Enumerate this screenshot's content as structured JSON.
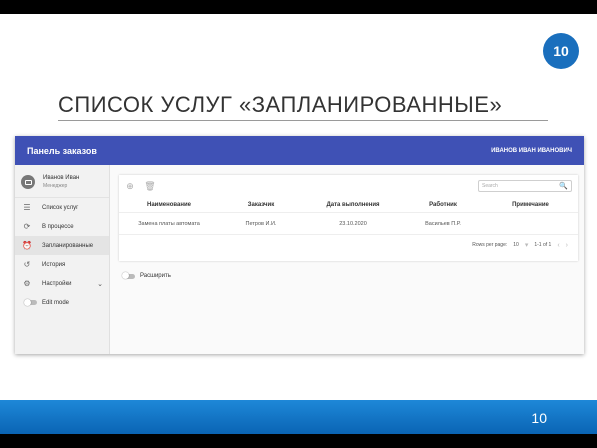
{
  "slide": {
    "badge": "10",
    "title": "СПИСОК УСЛУГ «ЗАПЛАНИРОВАННЫЕ»",
    "page_number": "10"
  },
  "app": {
    "header_title": "Панель заказов",
    "header_user": "ИВАНОВ ИВАН ИВАНОВИЧ"
  },
  "sidebar": {
    "user_name": "Иванов Иван",
    "user_role": "Менеджер",
    "items": [
      {
        "label": "Список услуг",
        "icon": "list-icon"
      },
      {
        "label": "В процессе",
        "icon": "sync-icon"
      },
      {
        "label": "Запланированные",
        "icon": "alarm-icon"
      },
      {
        "label": "История",
        "icon": "history-icon"
      },
      {
        "label": "Настройки",
        "icon": "gear-icon"
      }
    ],
    "edit_mode_label": "Edit mode"
  },
  "table": {
    "search_placeholder": "Search",
    "columns": [
      "Наименование",
      "Заказчик",
      "Дата выполнения",
      "Работник",
      "Примечание"
    ],
    "rows": [
      [
        "Замена платы автомата",
        "Петров И.И.",
        "23.10.2020",
        "Васильев П.Р.",
        ""
      ]
    ],
    "rows_per_page_label": "Rows per page:",
    "rows_per_page_value": "10",
    "range_text": "1-1 of 1"
  },
  "expand_label": "Расширить",
  "colors": {
    "header": "#3f51b5",
    "blue_bar": "#1e88d8",
    "badge": "#1a6fbd"
  }
}
